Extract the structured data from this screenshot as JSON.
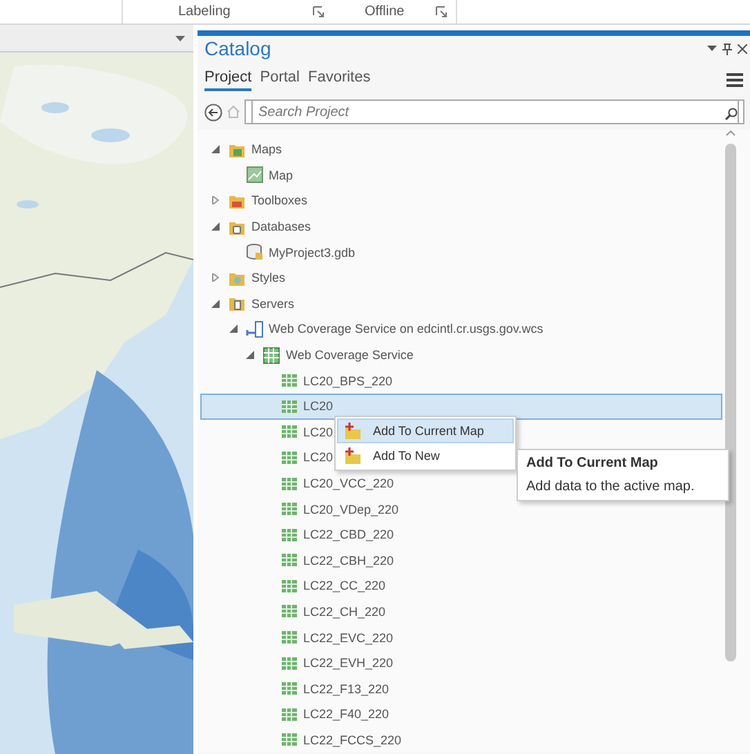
{
  "ribbon": {
    "groups": [
      "Labeling",
      "Offline"
    ]
  },
  "catalog": {
    "title": "Catalog",
    "tabs": [
      {
        "label": "Project",
        "selected": true
      },
      {
        "label": "Portal",
        "selected": false
      },
      {
        "label": "Favorites",
        "selected": false
      }
    ],
    "search": {
      "placeholder": "Search Project"
    },
    "tree": [
      {
        "label": "Maps",
        "kind": "maps",
        "expanded": true,
        "selected": false,
        "children": [
          {
            "label": "Map",
            "kind": "map",
            "selected": false
          }
        ]
      },
      {
        "label": "Toolboxes",
        "kind": "toolbox",
        "expanded": false,
        "selected": false
      },
      {
        "label": "Databases",
        "kind": "database",
        "expanded": true,
        "selected": false,
        "children": [
          {
            "label": "MyProject3.gdb",
            "kind": "gdb",
            "selected": false
          }
        ]
      },
      {
        "label": "Styles",
        "kind": "styles",
        "expanded": false,
        "selected": false
      },
      {
        "label": "Servers",
        "kind": "servers",
        "expanded": true,
        "selected": false,
        "children": [
          {
            "label": "Web Coverage Service on edcintl.cr.usgs.gov.wcs",
            "kind": "server",
            "expanded": true,
            "selected": false,
            "children": [
              {
                "label": "Web Coverage Service",
                "kind": "coverage",
                "expanded": true,
                "selected": false,
                "children": [
                  {
                    "label": "LC20_BPS_220",
                    "kind": "raster",
                    "selected": false
                  },
                  {
                    "label": "LC20",
                    "kind": "raster",
                    "selected": true
                  },
                  {
                    "label": "LC20",
                    "kind": "raster",
                    "selected": false
                  },
                  {
                    "label": "LC20",
                    "kind": "raster",
                    "selected": false
                  },
                  {
                    "label": "LC20_VCC_220",
                    "kind": "raster",
                    "selected": false
                  },
                  {
                    "label": "LC20_VDep_220",
                    "kind": "raster",
                    "selected": false
                  },
                  {
                    "label": "LC22_CBD_220",
                    "kind": "raster",
                    "selected": false
                  },
                  {
                    "label": "LC22_CBH_220",
                    "kind": "raster",
                    "selected": false
                  },
                  {
                    "label": "LC22_CC_220",
                    "kind": "raster",
                    "selected": false
                  },
                  {
                    "label": "LC22_CH_220",
                    "kind": "raster",
                    "selected": false
                  },
                  {
                    "label": "LC22_EVC_220",
                    "kind": "raster",
                    "selected": false
                  },
                  {
                    "label": "LC22_EVH_220",
                    "kind": "raster",
                    "selected": false
                  },
                  {
                    "label": "LC22_F13_220",
                    "kind": "raster",
                    "selected": false
                  },
                  {
                    "label": "LC22_F40_220",
                    "kind": "raster",
                    "selected": false
                  },
                  {
                    "label": "LC22_FCCS_220",
                    "kind": "raster",
                    "selected": false
                  }
                ]
              }
            ]
          }
        ]
      }
    ]
  },
  "context_menu": {
    "items": [
      {
        "label": "Add To Current Map",
        "selected": true
      },
      {
        "label": "Add To New",
        "selected": false
      }
    ]
  },
  "tooltip": {
    "title": "Add To Current Map",
    "text": "Add data to the active map."
  }
}
